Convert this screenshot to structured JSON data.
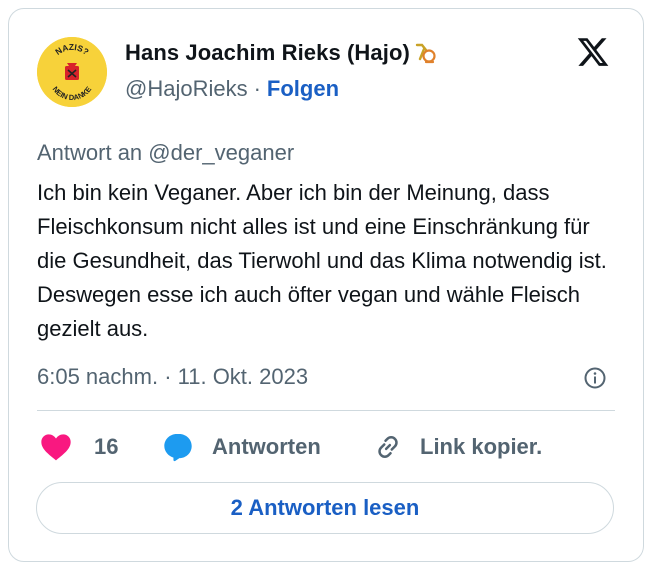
{
  "author": {
    "name": "Hans Joachim Rieks (Hajo)",
    "handle": "@HajoRieks",
    "separator": "·",
    "follow_label": "Folgen",
    "avatar_text_top": "NAZIS?",
    "avatar_text_bottom": "NEIN DANKE"
  },
  "icons": {
    "platform": "x-logo-icon",
    "badge": "horn-icon",
    "info": "info-icon",
    "like": "heart-icon",
    "reply": "speech-bubble-icon",
    "link": "link-icon"
  },
  "tweet": {
    "reply_to": "Antwort an @der_veganer",
    "text": "Ich bin kein Veganer. Aber ich bin der Meinung, dass Fleischkonsum nicht alles ist und eine Einschränkung für die Gesundheit, das Tierwohl und das Klima notwendig ist. Deswegen esse ich auch öfter vegan und wähle Fleisch gezielt aus.",
    "timestamp": "6:05 nachm. · 11. Okt. 2023"
  },
  "actions": {
    "like_count": "16",
    "reply_label": "Antworten",
    "link_label": "Link kopier."
  },
  "footer": {
    "read_replies_label": "2 Antworten lesen"
  },
  "colors": {
    "link": "#1a5fc4",
    "like": "#f91880",
    "reply": "#1d9bf0",
    "muted": "#536471",
    "border": "#cfd9de"
  }
}
